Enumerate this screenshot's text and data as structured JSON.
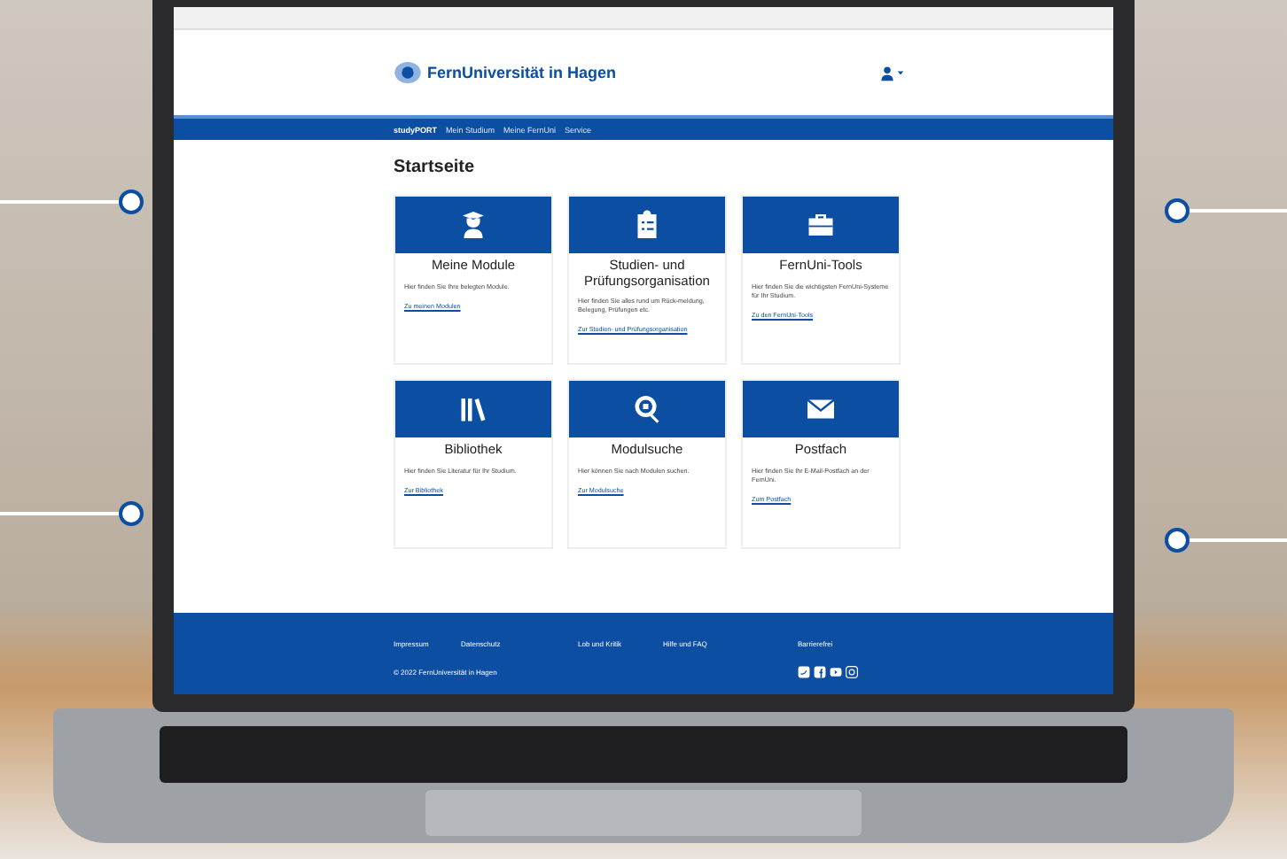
{
  "header": {
    "logo_text": "FernUniversität in Hagen"
  },
  "nav": {
    "items": [
      {
        "label": "studyPORT",
        "selected": true
      },
      {
        "label": "Mein Studium",
        "selected": false
      },
      {
        "label": "Meine FernUni",
        "selected": false
      },
      {
        "label": "Service",
        "selected": false
      }
    ]
  },
  "page_title": "Startseite",
  "cards": [
    {
      "title": "Meine Module",
      "text": "Hier finden Sie Ihre belegten Module.",
      "link": "Zu meinen Modulen"
    },
    {
      "title": "Studien- und Prüfungsorganisation",
      "text": "Hier finden Sie alles rund um Rück-meldung, Belegung, Prüfungen etc.",
      "link": "Zur Studien- und Prüfungsorganisation"
    },
    {
      "title": "FernUni-Tools",
      "text": "Hier finden Sie die wichtigsten FernUni-Systeme für Ihr Studium.",
      "link": "Zu den FernUni-Tools"
    },
    {
      "title": "Bibliothek",
      "text": "Hier finden Sie Literatur für Ihr Studium.",
      "link": "Zur Bibliothek"
    },
    {
      "title": "Modulsuche",
      "text": "Hier können Sie nach Modulen suchen.",
      "link": "Zur Modulsuche"
    },
    {
      "title": "Postfach",
      "text": "Hier finden Sie Ihr E-Mail-Postfach an der FernUni.",
      "link": "Zum Postfach"
    }
  ],
  "footer": {
    "links": [
      "Impressum",
      "Datenschutz",
      "Lob und Kritik",
      "Hilfe und FAQ",
      "Barrierefrei"
    ],
    "copyright": "© 2022 FernUniversität in Hagen"
  }
}
